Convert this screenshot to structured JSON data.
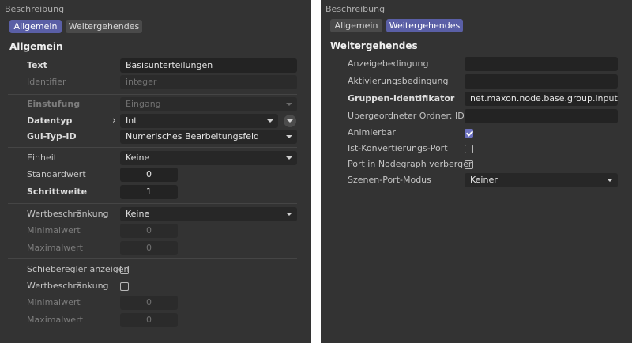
{
  "left": {
    "header": "Beschreibung",
    "tabs": [
      "Allgemein",
      "Weitergehendes"
    ],
    "section": "Allgemein",
    "text": {
      "label": "Text",
      "value": "Basisunterteilungen"
    },
    "identifier": {
      "label": "Identifier",
      "placeholder": "integer"
    },
    "einstufung": {
      "label": "Einstufung",
      "value": "Eingang"
    },
    "datentyp": {
      "label": "Datentyp",
      "value": "Int"
    },
    "gui_typ_id": {
      "label": "Gui-Typ-ID",
      "value": "Numerisches Bearbeitungsfeld"
    },
    "einheit": {
      "label": "Einheit",
      "value": "Keine"
    },
    "standardwert": {
      "label": "Standardwert",
      "value": "0"
    },
    "schrittweite": {
      "label": "Schrittweite",
      "value": "1"
    },
    "wertbeschraenkung": {
      "label": "Wertbeschränkung",
      "value": "Keine"
    },
    "minimalwert": {
      "label": "Minimalwert",
      "value": "0"
    },
    "maximalwert": {
      "label": "Maximalwert",
      "value": "0"
    },
    "schieberegler": {
      "label": "Schieberegler anzeigen",
      "checked": false
    },
    "wertbeschraenkung2": {
      "label": "Wertbeschränkung",
      "checked": false
    },
    "minimalwert2": {
      "label": "Minimalwert",
      "value": "0"
    },
    "maximalwert2": {
      "label": "Maximalwert",
      "value": "0"
    }
  },
  "right": {
    "header": "Beschreibung",
    "tabs": [
      "Allgemein",
      "Weitergehendes"
    ],
    "section": "Weitergehendes",
    "anzeigebedingung": {
      "label": "Anzeigebedingung",
      "value": ""
    },
    "aktivierungsbedingung": {
      "label": "Aktivierungsbedingung",
      "value": ""
    },
    "gruppen_identifikator": {
      "label": "Gruppen-Identifikator",
      "value": "net.maxon.node.base.group.inputs"
    },
    "uebergeordneter_ordner": {
      "label": "Übergeordneter Ordner: ID",
      "value": ""
    },
    "animierbar": {
      "label": "Animierbar",
      "checked": true
    },
    "ist_konvertierungs_port": {
      "label": "Ist-Konvertierungs-Port",
      "checked": false
    },
    "port_verbergen": {
      "label": "Port in Nodegraph verbergen",
      "checked": false
    },
    "szenen_port_modus": {
      "label": "Szenen-Port-Modus",
      "value": "Keiner"
    }
  },
  "colors": {
    "accent": "#5a5fa6",
    "panel": "#333333",
    "field": "#232323",
    "checkbox_checked": "#6d72c0"
  }
}
